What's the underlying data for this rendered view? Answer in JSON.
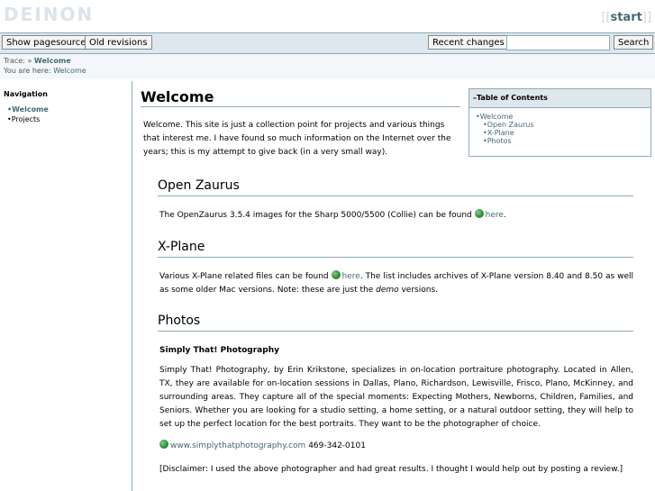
{
  "header": {
    "logo": "Deinon",
    "start_link": "start",
    "bracket_open": "[[",
    "bracket_close": "]]"
  },
  "toolbar": {
    "show_source": "Show pagesource",
    "old_revisions": "Old revisions",
    "recent_changes": "Recent changes",
    "search_button": "Search",
    "search_value": ""
  },
  "breadcrumbs": {
    "trace_label": "Trace:",
    "trace_sep": "»",
    "trace_page": "Welcome",
    "you_are_here_label": "You are here:",
    "you_are_here_page": "Welcome"
  },
  "sidebar": {
    "heading": "Navigation",
    "items": [
      {
        "label": "•Welcome",
        "active": true
      },
      {
        "label": "•Projects",
        "active": false
      }
    ]
  },
  "main": {
    "title": "Welcome",
    "toc": {
      "heading": "–Table of Contents",
      "items": [
        "•Welcome",
        "•Open Zaurus",
        "•X-Plane",
        "•Photos"
      ]
    },
    "intro": "Welcome. This site is just a collection point for projects and various things that interest me. I have found so much information on the Internet over the years; this is my attempt to give back (in a very small way).",
    "zaurus": {
      "heading": "Open Zaurus",
      "text_before": "The OpenZaurus 3.5.4 images for the Sharp 5000/5500 (Collie) can be found ",
      "link": "here",
      "text_after": "."
    },
    "xplane": {
      "heading": "X-Plane",
      "text_before": "Various X-Plane related files can be found ",
      "link": "here",
      "text_mid": ". The list includes archives of X-Plane version 8.40 and 8.50 as well as some older Mac versions. Note: these are just the ",
      "emph": "demo",
      "text_after": " versions."
    },
    "photos": {
      "heading": "Photos",
      "subheading": "Simply That! Photography",
      "description": "Simply That! Photography, by Erin Krikstone, specializes in on-location portraiture photography. Located in Allen, TX, they are available for on-location sessions in Dallas, Plano, Richardson, Lewisville, Frisco, Plano, McKinney, and surrounding areas. They capture all of the special moments: Expecting Mothers, Newborns, Children, Families, and Seniors. Whether you are looking for a studio setting, a home setting, or a natural outdoor setting, they will help to set up the perfect location for the best portraits. They want to be the photographer of choice.",
      "website": "www.simplythatphotography.com",
      "phone": " 469-342-0101",
      "disclaimer": "[Disclaimer: I used the above photographer and had great results. I thought I would help out by posting a review.]"
    }
  }
}
